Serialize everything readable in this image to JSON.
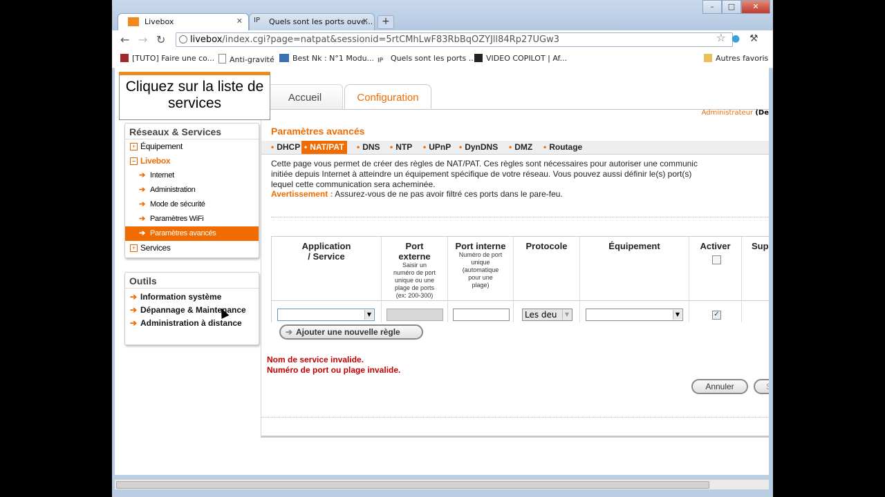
{
  "browser": {
    "tabs": [
      {
        "title": "Livebox",
        "active": true
      },
      {
        "title": "Quels sont les ports ouve...",
        "active": false
      }
    ],
    "url": {
      "host": "livebox",
      "path": "/index.cgi?page=natpat&sessionid=5rtCMhLwF83RbBqOZYJll84Rp27UGw3"
    },
    "bookmarks": [
      "[TUTO] Faire une co...",
      "Anti-gravité",
      "Best Nk : N°1 Modu...",
      "Quels sont les ports ...",
      "VIDEO COPILOT | Af..."
    ],
    "other_bookmarks": "Autres favoris",
    "tab_prefix_ip": "IP"
  },
  "hint": "Cliquez sur la liste de services",
  "top_tabs": {
    "home": "Accueil",
    "config": "Configuration"
  },
  "admin": {
    "label": "Administrateur",
    "extra": "(De"
  },
  "sidebar": {
    "section1_title": "Réseaux & Services",
    "equipement": "Équipement",
    "livebox": "Livebox",
    "livebox_items": [
      "Internet",
      "Administration",
      "Mode de sécurité",
      "Paramètres WiFi",
      "Paramètres avancés"
    ],
    "services": "Services",
    "outils_title": "Outils",
    "outils_items": [
      "Information système",
      "Dépannage & Maintenance",
      "Administration à distance"
    ]
  },
  "main": {
    "title": "Paramètres avancés",
    "subnav": [
      "DHCP",
      "NAT/PAT",
      "DNS",
      "NTP",
      "UPnP",
      "DynDNS",
      "DMZ",
      "Routage"
    ],
    "description": "Cette page vous permet de créer des règles de NAT/PAT. Ces règles sont nécessaires pour autoriser une communic\ninitiée depuis Internet à atteindre un équipement spécifique de votre réseau. Vous pouvez aussi définir le(s) port(s)\nlequel cette communication sera acheminée.",
    "warning_label": "Avertissement :",
    "warning_text": " Assurez-vous de ne pas avoir filtré ces ports dans le pare-feu."
  },
  "table": {
    "headers": {
      "app": "Application\n/ Service",
      "ext": "Port\nexterne",
      "ext_sub": "Saisir un\nnuméro de port\nunique ou une\nplage de ports\n(ex: 200-300)",
      "int": "Port interne",
      "int_sub": "Numéro de port\nunique\n(automatique\npour une\nplage)",
      "proto": "Protocole",
      "equip": "Équipement",
      "activer": "Activer",
      "supp": "Supp"
    },
    "row": {
      "protocol": "Les deu",
      "activer_checked": true
    }
  },
  "buttons": {
    "add_rule": "Ajouter une nouvelle règle",
    "cancel": "Annuler",
    "save_partial": "S"
  },
  "errors": [
    "Nom de service invalide.",
    "Numéro de port ou plage invalide."
  ],
  "colors": {
    "orange": "#f06c00",
    "error": "#c00000"
  }
}
